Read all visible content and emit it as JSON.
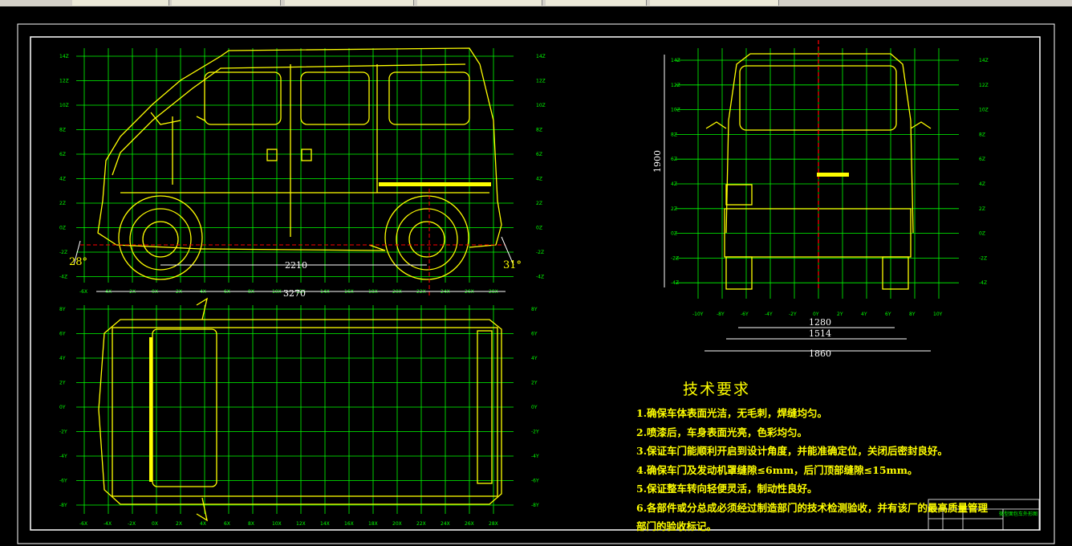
{
  "notes": {
    "title": "技术要求",
    "items": [
      "1.确保车体表面光洁，无毛刺，焊缝均匀。",
      "2.喷漆后，车身表面光亮，色彩均匀。",
      "3.保证车门能顺利开启到设计角度，并能准确定位，关闭后密封良好。",
      "4.确保车门及发动机罩缝隙≤6mm，后门顶部缝隙≤15mm。",
      "5.保证整车转向轻便灵活，制动性良好。",
      "6.各部件或分总成必须经过制造部门的技术检测验收，并有该厂的最高质量管理部门的验收标记。"
    ]
  },
  "dimensions": {
    "wheelbase": "2210",
    "length": "3270",
    "height": "1900",
    "track_rear": "1280",
    "track_front": "1514",
    "width": "1860",
    "approach_angle": "28°",
    "departure_angle": "31°"
  },
  "grid_ticks": {
    "side_y": [
      "14Z",
      "12Z",
      "10Z",
      "8Z",
      "6Z",
      "4Z",
      "2Z",
      "0Z",
      "-2Z",
      "-4Z"
    ],
    "side_x": [
      "-6X",
      "-4X",
      "-2X",
      "0X",
      "2X",
      "4X",
      "6X",
      "8X",
      "10X",
      "12X",
      "14X",
      "16X",
      "18X",
      "20X",
      "22X",
      "24X",
      "26X",
      "28X"
    ],
    "top_y": [
      "8Y",
      "6Y",
      "4Y",
      "2Y",
      "0Y",
      "-2Y",
      "-4Y",
      "-6Y",
      "-8Y"
    ],
    "front_y": [
      "14Z",
      "12Z",
      "10Z",
      "8Z",
      "6Z",
      "4Z",
      "2Z",
      "0Z",
      "-2Z",
      "-4Z"
    ],
    "front_x": [
      "-10Y",
      "-8Y",
      "-6Y",
      "-4Y",
      "-2Y",
      "0Y",
      "2Y",
      "4Y",
      "6Y",
      "8Y",
      "10Y"
    ]
  },
  "title_block": {
    "label": "微型面包车外形图"
  },
  "colors": {
    "grid": "#00ff00",
    "body": "#ffff00",
    "dim": "#ffffff",
    "redline": "#ff0000",
    "frame": "#ffffff"
  }
}
